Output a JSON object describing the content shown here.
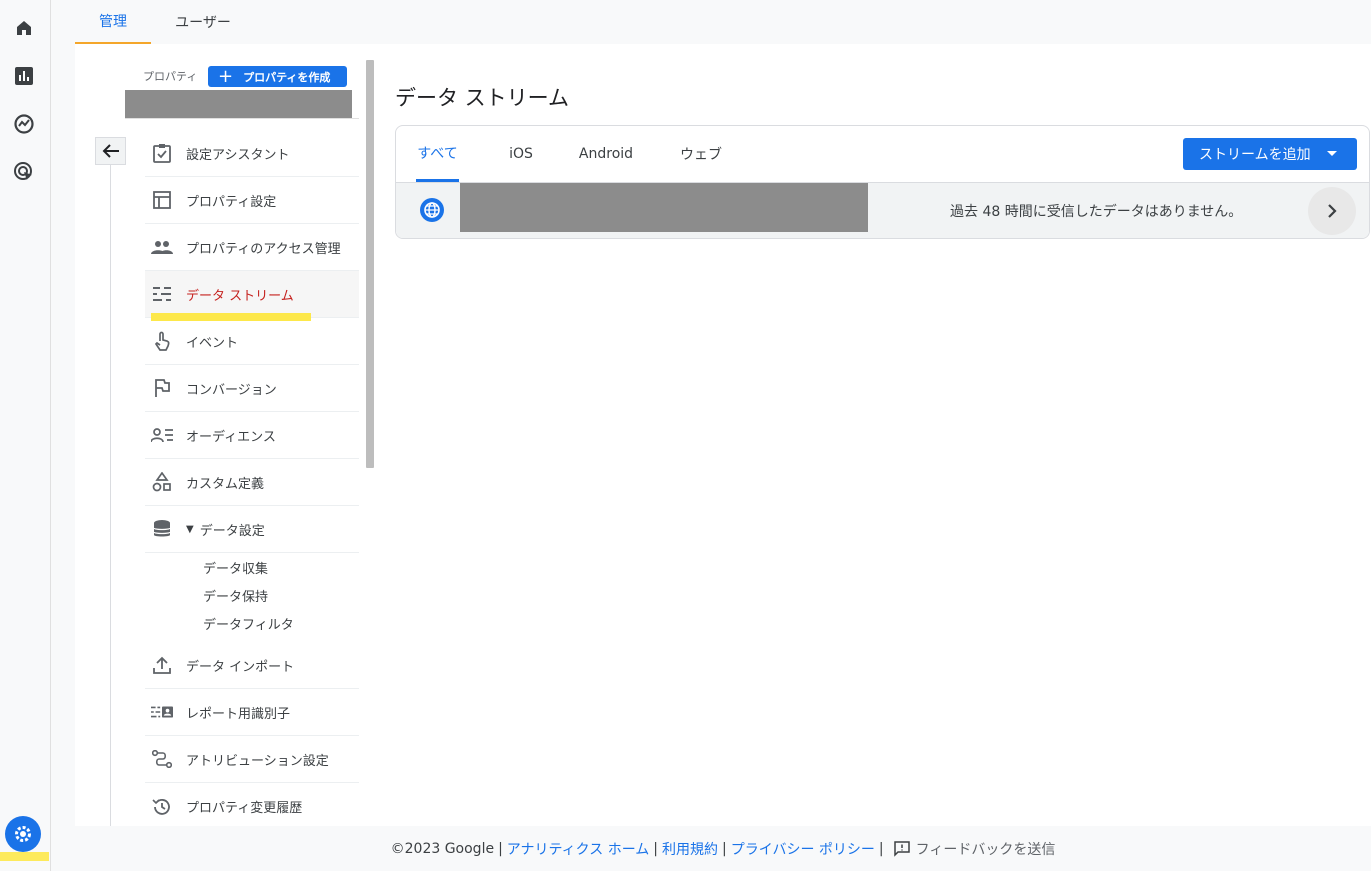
{
  "top_tabs": [
    {
      "label": "管理"
    },
    {
      "label": "ユーザー"
    }
  ],
  "rail": {
    "icons": [
      "home-icon",
      "reports-icon",
      "explore-icon",
      "advertising-icon"
    ],
    "settings_icon": "settings-icon"
  },
  "property": {
    "label": "プロパティ",
    "create_button": "プロパティを作成"
  },
  "menu": {
    "setup_assistant": "設定アシスタント",
    "property_settings": "プロパティ設定",
    "access_management": "プロパティのアクセス管理",
    "data_streams": "データ ストリーム",
    "events": "イベント",
    "conversions": "コンバージョン",
    "audiences": "オーディエンス",
    "custom_definitions": "カスタム定義",
    "data_settings": "データ設定",
    "data_collection": "データ収集",
    "data_retention": "データ保持",
    "data_filters": "データフィルタ",
    "data_import": "データ インポート",
    "reporting_identity": "レポート用識別子",
    "attribution_settings": "アトリビューション設定",
    "change_history": "プロパティ変更履歴"
  },
  "main": {
    "title": "データ ストリーム",
    "tabs": [
      {
        "label": "すべて"
      },
      {
        "label": "iOS"
      },
      {
        "label": "Android"
      },
      {
        "label": "ウェブ"
      }
    ],
    "add_stream_button": "ストリームを追加",
    "stream_status": "過去 48 時間に受信したデータはありません。"
  },
  "footer": {
    "copyright": "©2023 Google",
    "sep": "|",
    "analytics_home": "アナリティクス ホーム",
    "terms": "利用規約",
    "privacy": "プライバシー ポリシー",
    "feedback": "フィードバックを送信"
  },
  "colors": {
    "accent": "#1a73e8",
    "active_menu": "#c5221f",
    "highlight": "#fde84a",
    "tab_underline": "#f4a62a"
  }
}
